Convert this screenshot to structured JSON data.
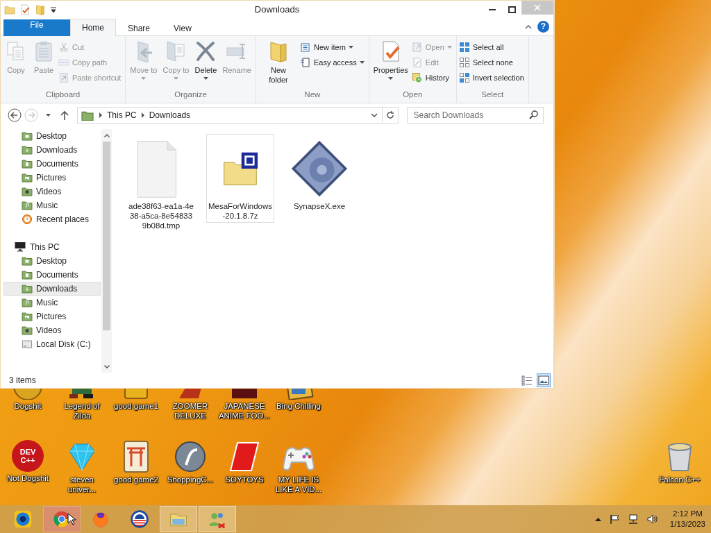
{
  "window": {
    "title": "Downloads"
  },
  "ribbon_tabs": [
    {
      "label": "File",
      "kind": "file",
      "selected": false
    },
    {
      "label": "Home",
      "kind": "tab",
      "selected": true
    },
    {
      "label": "Share",
      "kind": "tab",
      "selected": false
    },
    {
      "label": "View",
      "kind": "tab",
      "selected": false
    }
  ],
  "ribbon_help": "?",
  "ribbon_groups": [
    {
      "name": "Clipboard",
      "large": [
        {
          "label": "Copy",
          "kind": "copy",
          "disabled": true,
          "dropdown": false
        },
        {
          "label": "Paste",
          "kind": "paste",
          "disabled": true,
          "dropdown": false
        }
      ],
      "small": [
        {
          "label": "Cut",
          "kind": "cut",
          "disabled": true,
          "dropdown": false
        },
        {
          "label": "Copy path",
          "kind": "copy_path",
          "disabled": true,
          "dropdown": false
        },
        {
          "label": "Paste shortcut",
          "kind": "paste_shortcut",
          "disabled": true,
          "dropdown": false
        }
      ]
    },
    {
      "name": "Organize",
      "large": [
        {
          "label": "Move to",
          "kind": "move_to",
          "disabled": true,
          "dropdown": true
        },
        {
          "label": "Copy to",
          "kind": "copy_to",
          "disabled": true,
          "dropdown": true
        },
        {
          "label": "Delete",
          "kind": "delete",
          "disabled": false,
          "dropdown": true
        },
        {
          "label": "Rename",
          "kind": "rename",
          "disabled": true,
          "dropdown": false
        }
      ]
    },
    {
      "name": "New",
      "large": [
        {
          "label": "New folder",
          "kind": "new_folder",
          "disabled": false,
          "dropdown": false
        }
      ],
      "small": [
        {
          "label": "New item",
          "kind": "new_item",
          "disabled": false,
          "dropdown": true
        },
        {
          "label": "Easy access",
          "kind": "easy_access",
          "disabled": false,
          "dropdown": true
        }
      ]
    },
    {
      "name": "Open",
      "large": [
        {
          "label": "Properties",
          "kind": "properties",
          "disabled": false,
          "dropdown": true
        }
      ],
      "small": [
        {
          "label": "Open",
          "kind": "open",
          "disabled": true,
          "dropdown": true
        },
        {
          "label": "Edit",
          "kind": "edit",
          "disabled": true,
          "dropdown": false
        },
        {
          "label": "History",
          "kind": "history",
          "disabled": false,
          "dropdown": false
        }
      ]
    },
    {
      "name": "Select",
      "small": [
        {
          "label": "Select all",
          "kind": "select_all",
          "disabled": false,
          "dropdown": false
        },
        {
          "label": "Select none",
          "kind": "select_none",
          "disabled": false,
          "dropdown": false
        },
        {
          "label": "Invert selection",
          "kind": "invert",
          "disabled": false,
          "dropdown": false
        }
      ]
    }
  ],
  "address_bar": {
    "path": [
      "This PC",
      "Downloads"
    ]
  },
  "search": {
    "placeholder": "Search Downloads"
  },
  "nav_pane": {
    "favorites": [
      {
        "label": "Desktop",
        "kind": "desktop",
        "selected": false
      },
      {
        "label": "Downloads",
        "kind": "downloads",
        "selected": false
      },
      {
        "label": "Documents",
        "kind": "documents",
        "selected": false
      },
      {
        "label": "Pictures",
        "kind": "pictures",
        "selected": false
      },
      {
        "label": "Videos",
        "kind": "videos",
        "selected": false
      },
      {
        "label": "Music",
        "kind": "music",
        "selected": false
      },
      {
        "label": "Recent places",
        "kind": "recent",
        "selected": false
      }
    ],
    "this_pc": {
      "label": "This PC",
      "selected": false,
      "children": [
        {
          "label": "Desktop",
          "kind": "desktop",
          "selected": false
        },
        {
          "label": "Documents",
          "kind": "documents",
          "selected": false
        },
        {
          "label": "Downloads",
          "kind": "downloads",
          "selected": true
        },
        {
          "label": "Music",
          "kind": "music",
          "selected": false
        },
        {
          "label": "Pictures",
          "kind": "pictures",
          "selected": false
        },
        {
          "label": "Videos",
          "kind": "videos",
          "selected": false
        },
        {
          "label": "Local Disk (C:)",
          "kind": "drive",
          "selected": false
        }
      ]
    }
  },
  "files": [
    {
      "name": "ade38f63-ea1a-4e38-a5ca-8e548339b08d.tmp",
      "kind": "blank",
      "selected": false
    },
    {
      "name": "MesaForWindows-20.1.8.7z",
      "kind": "archive",
      "selected": true
    },
    {
      "name": "SynapseX.exe",
      "kind": "executable",
      "selected": false
    }
  ],
  "status_bar": {
    "item_count": "3 items",
    "views": [
      {
        "kind": "details",
        "selected": false
      },
      {
        "kind": "large_icons",
        "selected": true
      }
    ]
  },
  "desktop_rows": [
    {
      "icons": [
        {
          "label": "Dogshit",
          "kind": "disc"
        },
        {
          "label": "Legend of Zilda",
          "kind": "sprite"
        },
        {
          "label": "good game1",
          "kind": "yellow_tile"
        },
        {
          "label": "ZOOMER DELUXE",
          "kind": "red_shape"
        },
        {
          "label": "JAPANESE ANIME FOO...",
          "kind": "dark_box"
        },
        {
          "label": "Bing Chilling",
          "kind": "picture"
        }
      ]
    },
    {
      "icons": [
        {
          "label": "Not Dogshit",
          "kind": "dev",
          "logo_text": "DEV C++"
        },
        {
          "label": "steven univer...",
          "kind": "gem"
        },
        {
          "label": "good game2",
          "kind": "torii"
        },
        {
          "label": "ShoppingC...",
          "kind": "sphere"
        },
        {
          "label": "SOYTOYS",
          "kind": "red_logo"
        },
        {
          "label": "MY LIFE IS LIKE A VID...",
          "kind": "gamepad"
        }
      ]
    }
  ],
  "corner_icon": {
    "label": "Falcon C++",
    "kind": "trash"
  },
  "taskbar": {
    "apps": [
      {
        "kind": "globe",
        "hovered": false,
        "open": false
      },
      {
        "kind": "browser",
        "hovered": true,
        "open": false
      },
      {
        "kind": "fox",
        "hovered": false,
        "open": false
      },
      {
        "kind": "circle_logo",
        "hovered": false,
        "open": false
      },
      {
        "kind": "folder",
        "hovered": false,
        "open": true
      },
      {
        "kind": "people",
        "hovered": false,
        "open": true
      }
    ],
    "clock": {
      "time": "2:12 PM",
      "date": "1/13/2023"
    }
  }
}
